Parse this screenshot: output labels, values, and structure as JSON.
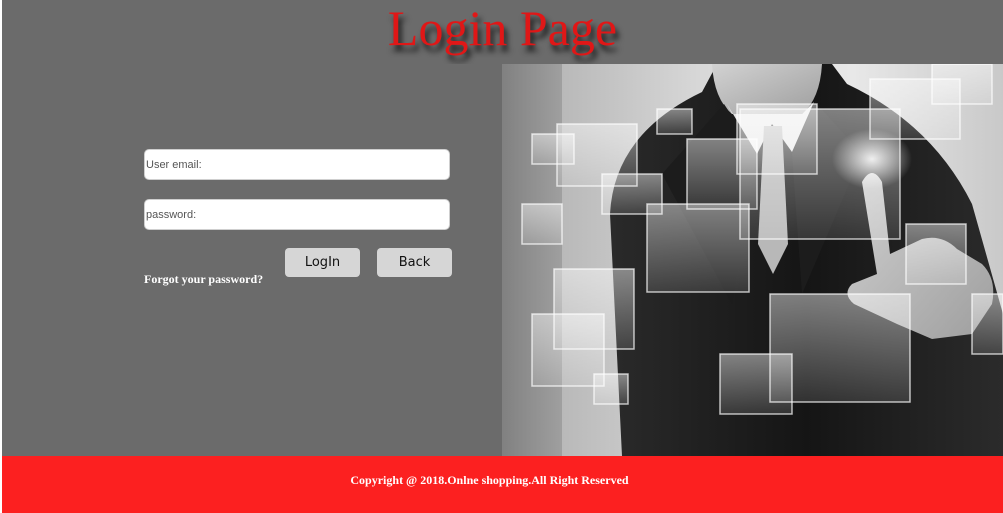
{
  "header": {
    "title": "Login Page"
  },
  "login_form": {
    "email_placeholder": "User email:",
    "password_placeholder": "password:",
    "login_label": "LogIn",
    "back_label": "Back",
    "forgot_label": "Forgot your password?"
  },
  "hero": {
    "image": "businessman-touching-virtual-screens"
  },
  "footer": {
    "copyright": "Copyright @ 2018.Onlne shopping.All Right Reserved"
  },
  "colors": {
    "background": "#6b6b6b",
    "title": "#e01717",
    "footer": "#fc2020",
    "button": "#d6d6d6"
  }
}
